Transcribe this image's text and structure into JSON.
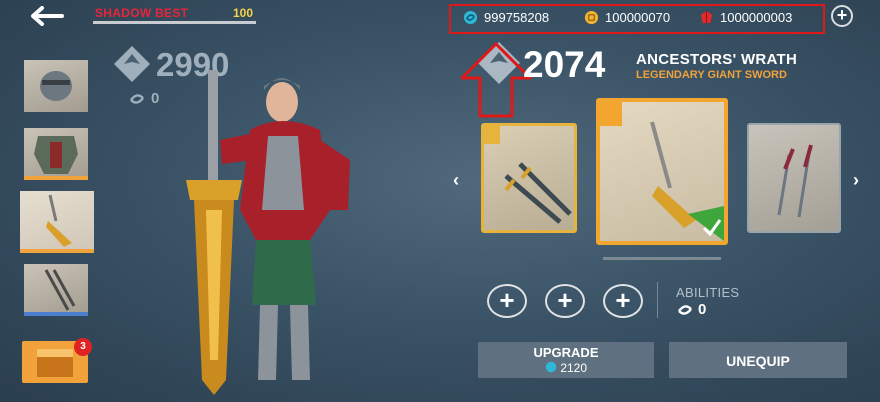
{
  "top_bar": {
    "shadow_best_label": "SHADOW BEST",
    "shadow_best_value": "100",
    "currencies": [
      {
        "icon": "gem-currency-icon",
        "value": "999758208",
        "color": "#2fb8d6"
      },
      {
        "icon": "gold-coin-icon",
        "value": "100000070",
        "color": "#f2b531"
      },
      {
        "icon": "ruby-currency-icon",
        "value": "1000000003",
        "color": "#e12a2a"
      }
    ]
  },
  "power": {
    "current": "2990",
    "current_sub": "0",
    "selected": "2074"
  },
  "weapon": {
    "name": "ANCESTORS' WRATH",
    "type": "LEGENDARY GIANT SWORD"
  },
  "abilities": {
    "label": "ABILITIES",
    "count": "0"
  },
  "buttons": {
    "upgrade_label": "UPGRADE",
    "upgrade_cost": "2120",
    "unequip_label": "UNEQUIP"
  },
  "badge_count": "3",
  "colors": {
    "accent_orange": "#f2a23a",
    "shadow_red": "#e8243a",
    "highlight_box": "#e01818",
    "equipped_green": "#3fa63c"
  }
}
